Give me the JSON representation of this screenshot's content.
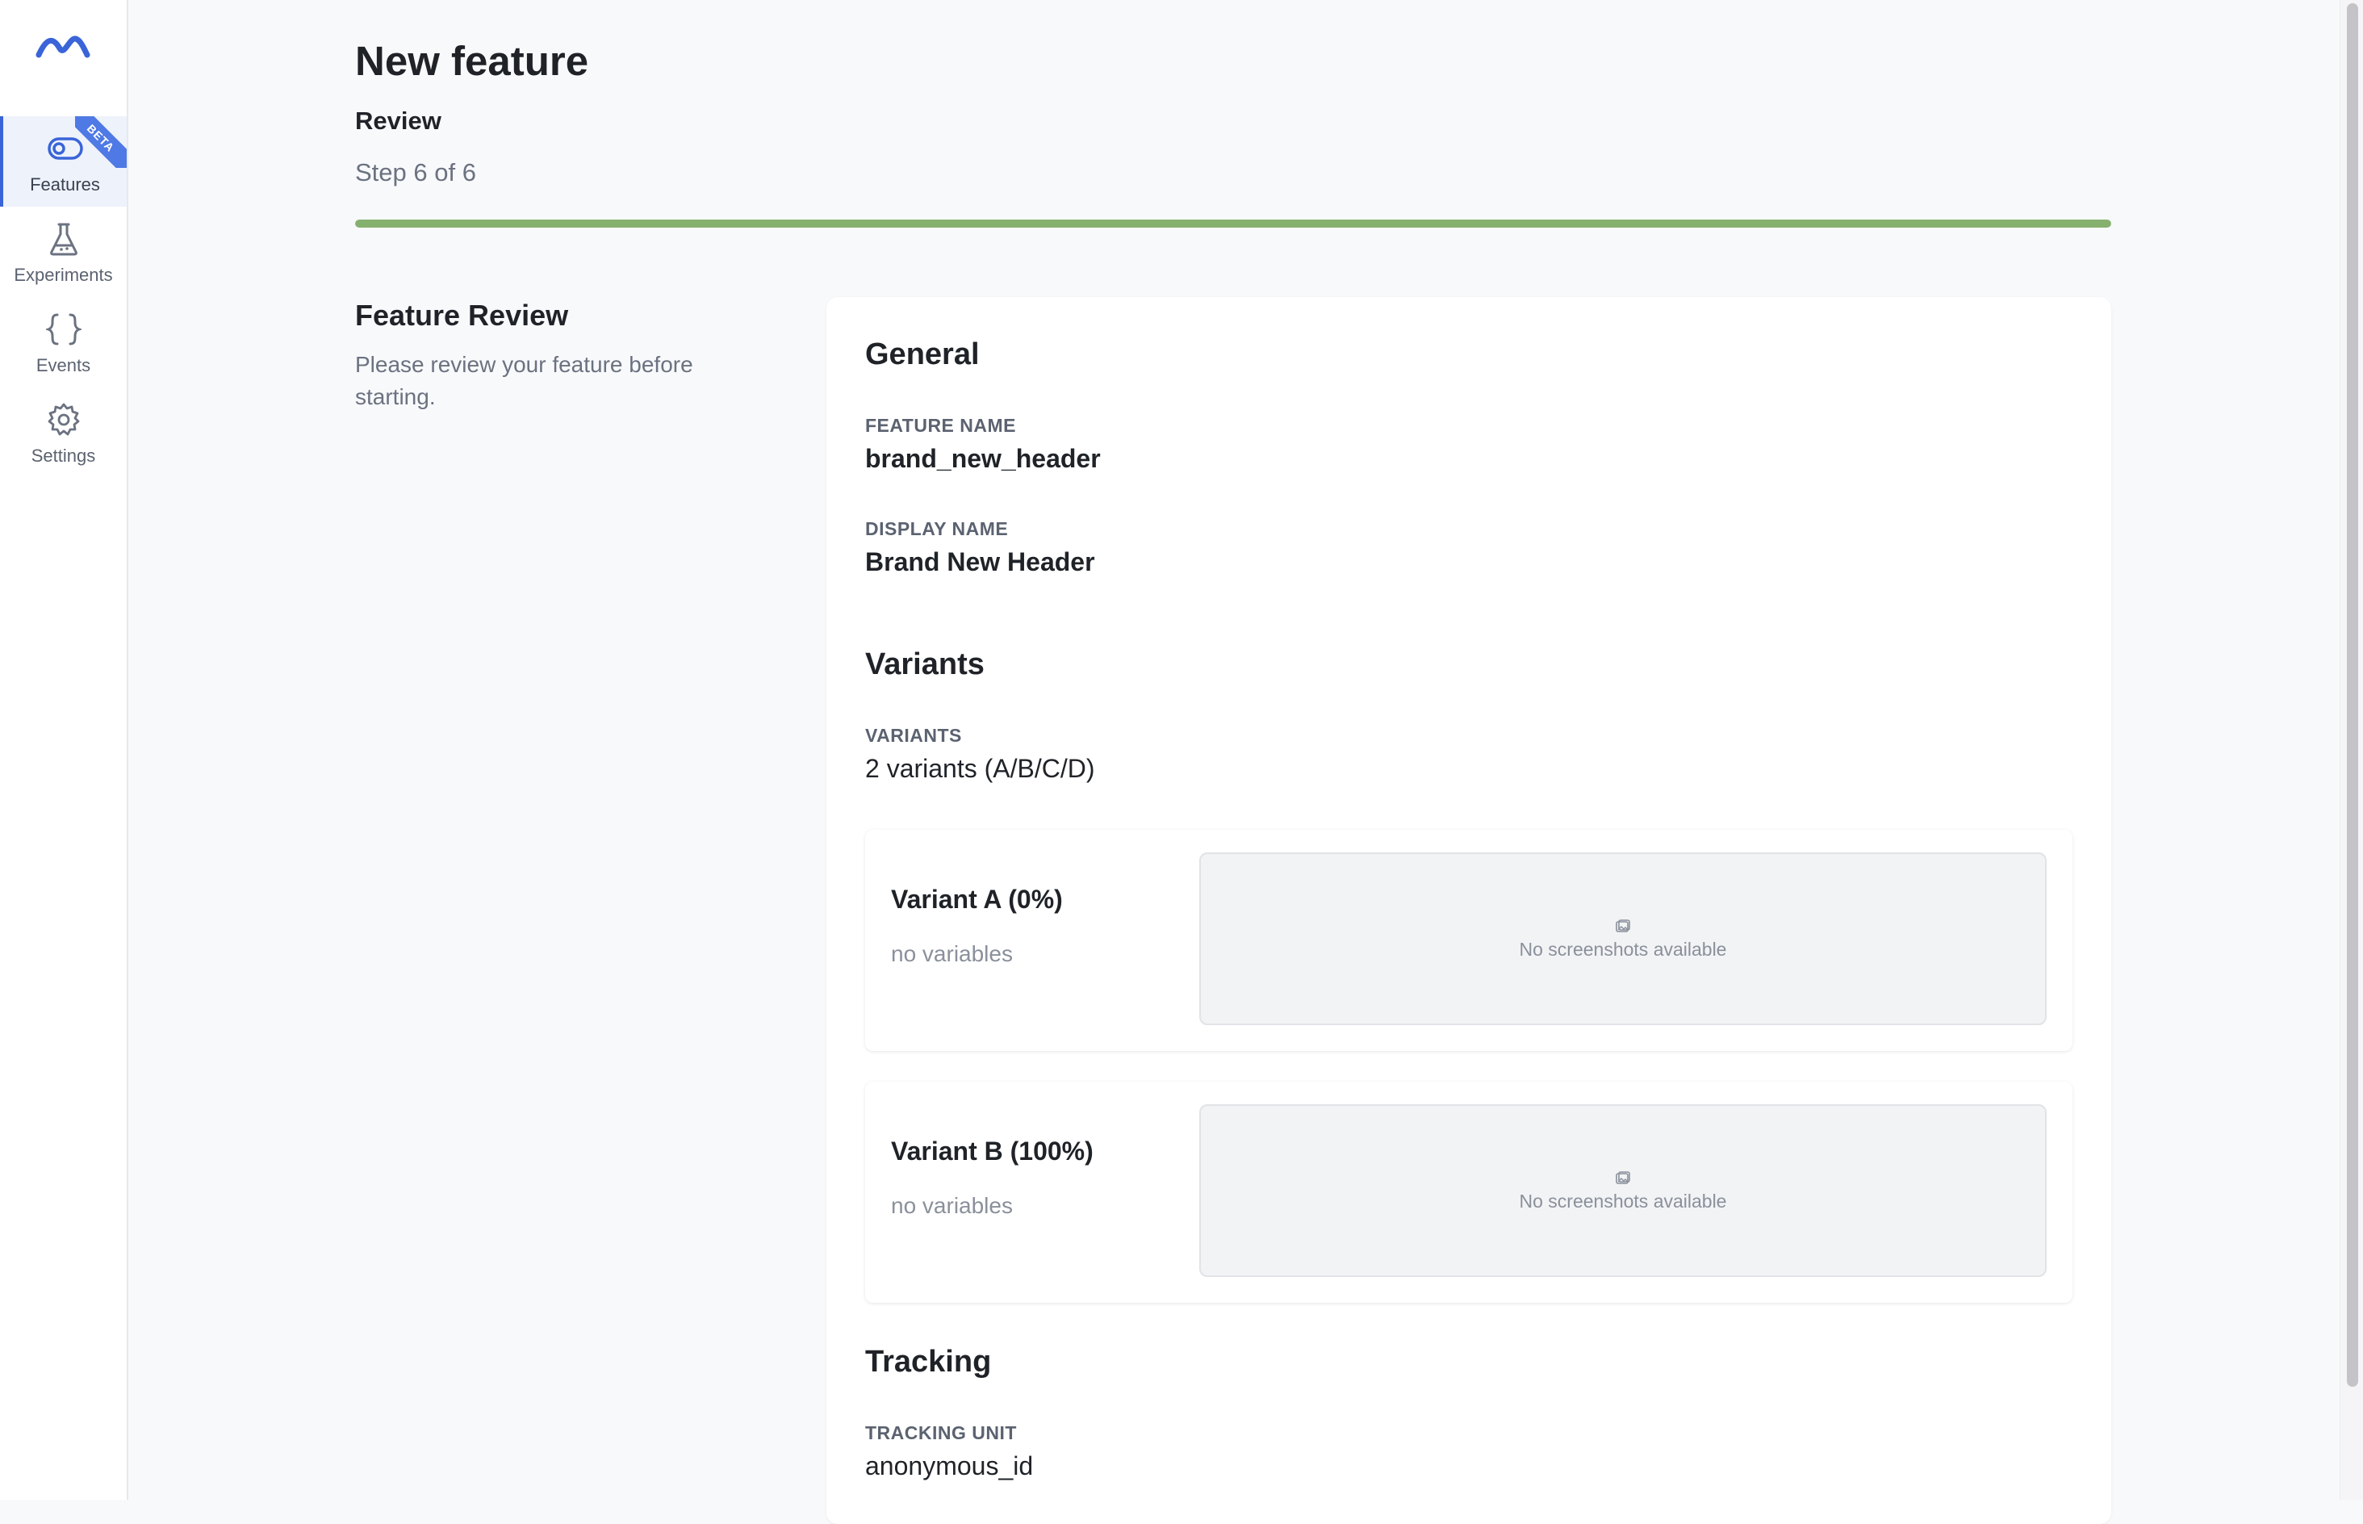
{
  "sidebar": {
    "logo_icon": "wave-logo-icon",
    "items": [
      {
        "label": "Features",
        "icon": "toggle-icon",
        "active": true,
        "badge": "BETA"
      },
      {
        "label": "Experiments",
        "icon": "flask-icon",
        "active": false
      },
      {
        "label": "Events",
        "icon": "braces-icon",
        "active": false
      },
      {
        "label": "Settings",
        "icon": "gear-icon",
        "active": false
      }
    ]
  },
  "header": {
    "title": "New feature",
    "step_name": "Review",
    "step_count": "Step 6 of 6",
    "progress_fraction": 1.0
  },
  "intro": {
    "heading": "Feature Review",
    "description": "Please review your feature before starting."
  },
  "general": {
    "title": "General",
    "feature_name_label": "FEATURE NAME",
    "feature_name": "brand_new_header",
    "display_name_label": "DISPLAY NAME",
    "display_name": "Brand New Header"
  },
  "variants": {
    "title": "Variants",
    "label": "VARIANTS",
    "summary": "2 variants (A/B/C/D)",
    "items": [
      {
        "name": "Variant A (0%)",
        "variables": "no variables",
        "screenshots": "No screenshots available"
      },
      {
        "name": "Variant B (100%)",
        "variables": "no variables",
        "screenshots": "No screenshots available"
      }
    ]
  },
  "tracking": {
    "title": "Tracking",
    "unit_label": "TRACKING UNIT",
    "unit": "anonymous_id"
  },
  "colors": {
    "accent": "#3a64d8",
    "progress": "#86b06e",
    "beta_badge": "#4f79e4"
  }
}
